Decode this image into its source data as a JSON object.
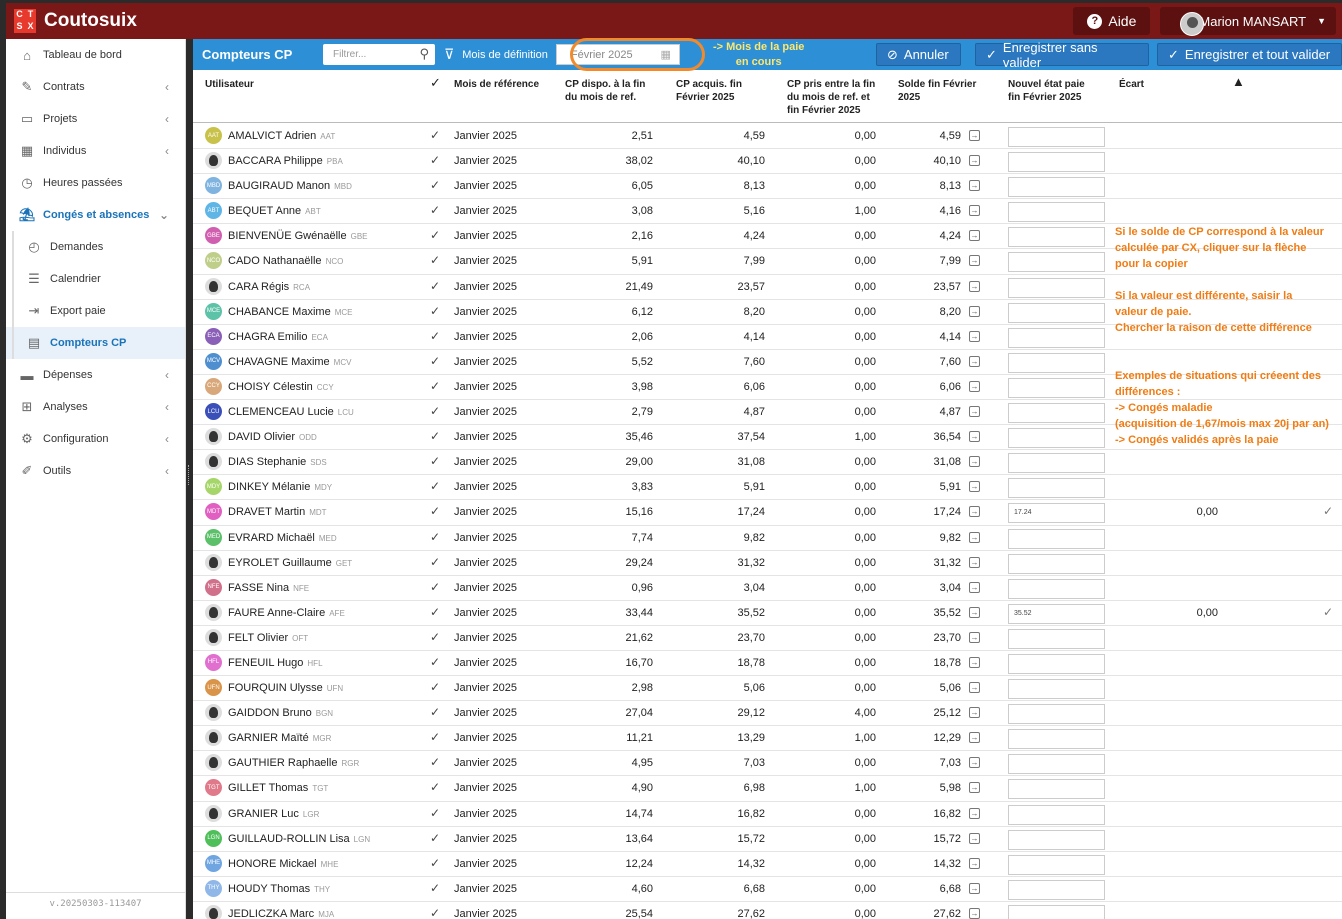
{
  "app": {
    "name": "Coutosuix",
    "logo_letters": [
      "C",
      "T",
      "S",
      "X"
    ],
    "help_label": "Aide",
    "user_name": "Marion MANSART",
    "version": "v.20250303-113407"
  },
  "sidebar": [
    {
      "label": "Tableau de bord",
      "icon": "home-icon",
      "chev": ""
    },
    {
      "label": "Contrats",
      "icon": "contract-icon",
      "chev": "‹"
    },
    {
      "label": "Projets",
      "icon": "folder-icon",
      "chev": "‹"
    },
    {
      "label": "Individus",
      "icon": "calendar-icon",
      "chev": "‹"
    },
    {
      "label": "Heures passées",
      "icon": "clock-icon",
      "chev": ""
    },
    {
      "label": "Congés et absences",
      "icon": "beach-icon",
      "chev": "⌄"
    },
    {
      "label": "Demandes",
      "icon": "history-icon",
      "chev": ""
    },
    {
      "label": "Calendrier",
      "icon": "timeline-icon",
      "chev": ""
    },
    {
      "label": "Export paie",
      "icon": "export-icon",
      "chev": ""
    },
    {
      "label": "Compteurs CP",
      "icon": "counter-icon",
      "chev": ""
    },
    {
      "label": "Dépenses",
      "icon": "money-icon",
      "chev": "‹"
    },
    {
      "label": "Analyses",
      "icon": "table-icon",
      "chev": "‹"
    },
    {
      "label": "Configuration",
      "icon": "gears-icon",
      "chev": "‹"
    },
    {
      "label": "Outils",
      "icon": "wrench-icon",
      "chev": "‹"
    }
  ],
  "toolbar": {
    "title": "Compteurs CP",
    "filter_placeholder": "Filtrer...",
    "mois_label": "Mois de définition",
    "date_value": "Février 2025",
    "annuler": "Annuler",
    "save_no_validate": "Enregistrer sans valider",
    "save_validate": "Enregistrer et tout valider"
  },
  "annotation_top": [
    "-> Mois de la paie",
    "en cours"
  ],
  "columns": {
    "user": "Utilisateur",
    "ref": "Mois de référence",
    "dispo": [
      "CP dispo. à la fin",
      "du mois de ref."
    ],
    "acquis": [
      "CP acquis. fin",
      "Février 2025"
    ],
    "pris": [
      "CP pris entre la fin",
      "du mois de ref. et",
      "fin Février 2025"
    ],
    "solde": [
      "Solde fin Février",
      "2025"
    ],
    "nouvel": [
      "Nouvel état paie",
      "fin Février 2025"
    ],
    "ecart": "Écart"
  },
  "notes": [
    [
      "Si le solde de CP correspond à la valeur",
      "calculée par CX, cliquer sur la flèche",
      "pour la copier"
    ],
    [
      "Si la valeur est différente, saisir la",
      "valeur de paie.",
      "Chercher la raison de cette différence"
    ],
    [
      "Exemples de situations qui créeent des",
      "différences :",
      "-> Congés maladie",
      "(acquisition de 1,67/mois max 20j par an)",
      "-> Congés validés après la paie"
    ]
  ],
  "rows": [
    {
      "name": "AMALVICT Adrien",
      "code": "AAT",
      "color": "#c9c24a",
      "photo": false,
      "ref": "Janvier 2025",
      "dispo": "2,51",
      "acquis": "4,59",
      "pris": "0,00",
      "solde": "4,59",
      "nouvel": "",
      "ecart": ""
    },
    {
      "name": "BACCARA Philippe",
      "code": "PBA",
      "color": "",
      "photo": true,
      "ref": "Janvier 2025",
      "dispo": "38,02",
      "acquis": "40,10",
      "pris": "0,00",
      "solde": "40,10",
      "nouvel": "",
      "ecart": ""
    },
    {
      "name": "BAUGIRAUD Manon",
      "code": "MBD",
      "color": "#7fb3e0",
      "photo": false,
      "ref": "Janvier 2025",
      "dispo": "6,05",
      "acquis": "8,13",
      "pris": "0,00",
      "solde": "8,13",
      "nouvel": "",
      "ecart": ""
    },
    {
      "name": "BEQUET Anne",
      "code": "ABT",
      "color": "#5fb6e6",
      "photo": false,
      "ref": "Janvier 2025",
      "dispo": "3,08",
      "acquis": "5,16",
      "pris": "1,00",
      "solde": "4,16",
      "nouvel": "",
      "ecart": ""
    },
    {
      "name": "BIENVENÜE Gwénaëlle",
      "code": "GBE",
      "color": "#d05fb0",
      "photo": false,
      "ref": "Janvier 2025",
      "dispo": "2,16",
      "acquis": "4,24",
      "pris": "0,00",
      "solde": "4,24",
      "nouvel": "",
      "ecart": ""
    },
    {
      "name": "CADO Nathanaëlle",
      "code": "NCO",
      "color": "#bfcf8a",
      "photo": false,
      "ref": "Janvier 2025",
      "dispo": "5,91",
      "acquis": "7,99",
      "pris": "0,00",
      "solde": "7,99",
      "nouvel": "",
      "ecart": ""
    },
    {
      "name": "CARA Régis",
      "code": "RCA",
      "color": "",
      "photo": true,
      "ref": "Janvier 2025",
      "dispo": "21,49",
      "acquis": "23,57",
      "pris": "0,00",
      "solde": "23,57",
      "nouvel": "",
      "ecart": ""
    },
    {
      "name": "CHABANCE Maxime",
      "code": "MCE",
      "color": "#5cc2a8",
      "photo": false,
      "ref": "Janvier 2025",
      "dispo": "6,12",
      "acquis": "8,20",
      "pris": "0,00",
      "solde": "8,20",
      "nouvel": "",
      "ecart": ""
    },
    {
      "name": "CHAGRA Emilio",
      "code": "ECA",
      "color": "#8a5fb8",
      "photo": false,
      "ref": "Janvier 2025",
      "dispo": "2,06",
      "acquis": "4,14",
      "pris": "0,00",
      "solde": "4,14",
      "nouvel": "",
      "ecart": ""
    },
    {
      "name": "CHAVAGNE Maxime",
      "code": "MCV",
      "color": "#4f8fd0",
      "photo": false,
      "ref": "Janvier 2025",
      "dispo": "5,52",
      "acquis": "7,60",
      "pris": "0,00",
      "solde": "7,60",
      "nouvel": "",
      "ecart": ""
    },
    {
      "name": "CHOISY Célestin",
      "code": "CCY",
      "color": "#d9a87a",
      "photo": false,
      "ref": "Janvier 2025",
      "dispo": "3,98",
      "acquis": "6,06",
      "pris": "0,00",
      "solde": "6,06",
      "nouvel": "",
      "ecart": ""
    },
    {
      "name": "CLEMENCEAU Lucie",
      "code": "LCU",
      "color": "#3a4fb8",
      "photo": false,
      "ref": "Janvier 2025",
      "dispo": "2,79",
      "acquis": "4,87",
      "pris": "0,00",
      "solde": "4,87",
      "nouvel": "",
      "ecart": ""
    },
    {
      "name": "DAVID Olivier",
      "code": "ODD",
      "color": "",
      "photo": true,
      "ref": "Janvier 2025",
      "dispo": "35,46",
      "acquis": "37,54",
      "pris": "1,00",
      "solde": "36,54",
      "nouvel": "",
      "ecart": ""
    },
    {
      "name": "DIAS Stephanie",
      "code": "SDS",
      "color": "",
      "photo": true,
      "ref": "Janvier 2025",
      "dispo": "29,00",
      "acquis": "31,08",
      "pris": "0,00",
      "solde": "31,08",
      "nouvel": "",
      "ecart": ""
    },
    {
      "name": "DINKEY Mélanie",
      "code": "MDY",
      "color": "#a6d66a",
      "photo": false,
      "ref": "Janvier 2025",
      "dispo": "3,83",
      "acquis": "5,91",
      "pris": "0,00",
      "solde": "5,91",
      "nouvel": "",
      "ecart": ""
    },
    {
      "name": "DRAVET Martin",
      "code": "MDT",
      "color": "#e05fc0",
      "photo": false,
      "ref": "Janvier 2025",
      "dispo": "15,16",
      "acquis": "17,24",
      "pris": "0,00",
      "solde": "17,24",
      "nouvel": "17.24",
      "ecart": "0,00"
    },
    {
      "name": "EVRARD Michaël",
      "code": "MED",
      "color": "#5cbf6a",
      "photo": false,
      "ref": "Janvier 2025",
      "dispo": "7,74",
      "acquis": "9,82",
      "pris": "0,00",
      "solde": "9,82",
      "nouvel": "",
      "ecart": ""
    },
    {
      "name": "EYROLET Guillaume",
      "code": "GET",
      "color": "",
      "photo": true,
      "ref": "Janvier 2025",
      "dispo": "29,24",
      "acquis": "31,32",
      "pris": "0,00",
      "solde": "31,32",
      "nouvel": "",
      "ecart": ""
    },
    {
      "name": "FASSE Nina",
      "code": "NFE",
      "color": "#d0708a",
      "photo": false,
      "ref": "Janvier 2025",
      "dispo": "0,96",
      "acquis": "3,04",
      "pris": "0,00",
      "solde": "3,04",
      "nouvel": "",
      "ecart": ""
    },
    {
      "name": "FAURE Anne-Claire",
      "code": "AFE",
      "color": "",
      "photo": true,
      "ref": "Janvier 2025",
      "dispo": "33,44",
      "acquis": "35,52",
      "pris": "0,00",
      "solde": "35,52",
      "nouvel": "35.52",
      "ecart": "0,00"
    },
    {
      "name": "FELT Olivier",
      "code": "OFT",
      "color": "",
      "photo": true,
      "ref": "Janvier 2025",
      "dispo": "21,62",
      "acquis": "23,70",
      "pris": "0,00",
      "solde": "23,70",
      "nouvel": "",
      "ecart": ""
    },
    {
      "name": "FENEUIL Hugo",
      "code": "HFL",
      "color": "#e06fd0",
      "photo": false,
      "ref": "Janvier 2025",
      "dispo": "16,70",
      "acquis": "18,78",
      "pris": "0,00",
      "solde": "18,78",
      "nouvel": "",
      "ecart": ""
    },
    {
      "name": "FOURQUIN Ulysse",
      "code": "UFN",
      "color": "#d9944a",
      "photo": false,
      "ref": "Janvier 2025",
      "dispo": "2,98",
      "acquis": "5,06",
      "pris": "0,00",
      "solde": "5,06",
      "nouvel": "",
      "ecart": ""
    },
    {
      "name": "GAIDDON Bruno",
      "code": "BGN",
      "color": "",
      "photo": true,
      "ref": "Janvier 2025",
      "dispo": "27,04",
      "acquis": "29,12",
      "pris": "4,00",
      "solde": "25,12",
      "nouvel": "",
      "ecart": ""
    },
    {
      "name": "GARNIER Maïté",
      "code": "MGR",
      "color": "",
      "photo": true,
      "ref": "Janvier 2025",
      "dispo": "11,21",
      "acquis": "13,29",
      "pris": "1,00",
      "solde": "12,29",
      "nouvel": "",
      "ecart": ""
    },
    {
      "name": "GAUTHIER Raphaelle",
      "code": "RGR",
      "color": "",
      "photo": true,
      "ref": "Janvier 2025",
      "dispo": "4,95",
      "acquis": "7,03",
      "pris": "0,00",
      "solde": "7,03",
      "nouvel": "",
      "ecart": ""
    },
    {
      "name": "GILLET Thomas",
      "code": "TGT",
      "color": "#e07a8a",
      "photo": false,
      "ref": "Janvier 2025",
      "dispo": "4,90",
      "acquis": "6,98",
      "pris": "1,00",
      "solde": "5,98",
      "nouvel": "",
      "ecart": ""
    },
    {
      "name": "GRANIER Luc",
      "code": "LGR",
      "color": "",
      "photo": true,
      "ref": "Janvier 2025",
      "dispo": "14,74",
      "acquis": "16,82",
      "pris": "0,00",
      "solde": "16,82",
      "nouvel": "",
      "ecart": ""
    },
    {
      "name": "GUILLAUD-ROLLIN Lisa",
      "code": "LGN",
      "color": "#4fbf5a",
      "photo": false,
      "ref": "Janvier 2025",
      "dispo": "13,64",
      "acquis": "15,72",
      "pris": "0,00",
      "solde": "15,72",
      "nouvel": "",
      "ecart": ""
    },
    {
      "name": "HONORE Mickael",
      "code": "MHE",
      "color": "#6fa5e0",
      "photo": false,
      "ref": "Janvier 2025",
      "dispo": "12,24",
      "acquis": "14,32",
      "pris": "0,00",
      "solde": "14,32",
      "nouvel": "",
      "ecart": ""
    },
    {
      "name": "HOUDY Thomas",
      "code": "THY",
      "color": "#8fb8e8",
      "photo": false,
      "ref": "Janvier 2025",
      "dispo": "4,60",
      "acquis": "6,68",
      "pris": "0,00",
      "solde": "6,68",
      "nouvel": "",
      "ecart": ""
    },
    {
      "name": "JEDLICZKA Marc",
      "code": "MJA",
      "color": "",
      "photo": true,
      "ref": "Janvier 2025",
      "dispo": "25,54",
      "acquis": "27,62",
      "pris": "0,00",
      "solde": "27,62",
      "nouvel": "",
      "ecart": ""
    }
  ]
}
